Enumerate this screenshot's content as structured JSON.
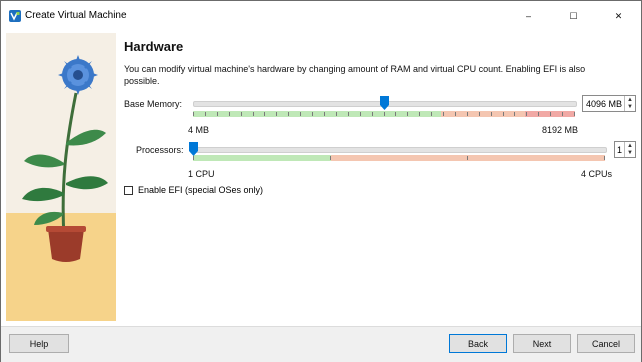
{
  "window": {
    "title": "Create Virtual Machine",
    "controls": {
      "minimize": "–",
      "maximize": "☐",
      "close": "✕"
    }
  },
  "page": {
    "title": "Hardware",
    "description": "You can modify virtual machine's hardware by changing amount of RAM and virtual CPU count. Enabling EFI is also possible."
  },
  "memory": {
    "label": "Base Memory:",
    "min_label": "4 MB",
    "max_label": "8192 MB",
    "value": "4096 MB",
    "level_fraction": 0.5
  },
  "processors": {
    "label": "Processors:",
    "min_label": "1 CPU",
    "max_label": "4 CPUs",
    "value": "1",
    "level_fraction": 0.0
  },
  "efi": {
    "label": "Enable EFI (special OSes only)",
    "checked": false
  },
  "buttons": {
    "help": "Help",
    "back": "Back",
    "next": "Next",
    "cancel": "Cancel"
  },
  "colors": {
    "accent": "#0078d7",
    "scale_green": "#bfe8b7",
    "scale_orange": "#f4c6b1",
    "scale_red": "#f1a9a5"
  }
}
